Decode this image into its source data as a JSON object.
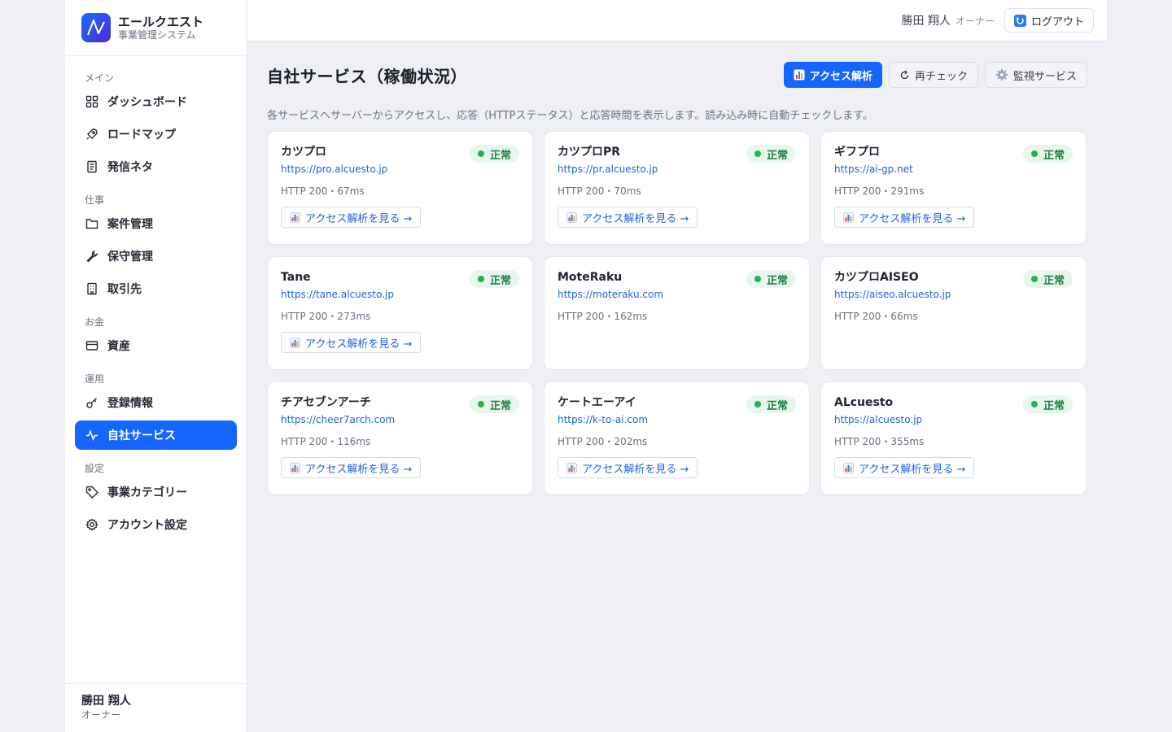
{
  "brand": {
    "name": "エールクエスト",
    "subtitle": "事業管理システム"
  },
  "nav": {
    "groups": [
      {
        "label": "メイン",
        "items": [
          {
            "label": "ダッシュボード",
            "icon": "grid-icon"
          },
          {
            "label": "ロードマップ",
            "icon": "rocket-icon"
          },
          {
            "label": "発信ネタ",
            "icon": "document-icon"
          }
        ]
      },
      {
        "label": "仕事",
        "items": [
          {
            "label": "案件管理",
            "icon": "folder-icon"
          },
          {
            "label": "保守管理",
            "icon": "wrench-icon"
          },
          {
            "label": "取引先",
            "icon": "building-icon"
          }
        ]
      },
      {
        "label": "お金",
        "items": [
          {
            "label": "資産",
            "icon": "credit-card-icon"
          }
        ]
      },
      {
        "label": "運用",
        "items": [
          {
            "label": "登録情報",
            "icon": "key-icon"
          },
          {
            "label": "自社サービス",
            "icon": "activity-icon",
            "active": true
          }
        ]
      },
      {
        "label": "設定",
        "items": [
          {
            "label": "事業カテゴリー",
            "icon": "tag-icon"
          },
          {
            "label": "アカウント設定",
            "icon": "gear-icon"
          }
        ]
      }
    ]
  },
  "user": {
    "name": "勝田 翔人",
    "role": "オーナー"
  },
  "topbar": {
    "user_name": "勝田 翔人",
    "user_role": "オーナー",
    "logout_label": "ログアウト"
  },
  "page": {
    "title": "自社サービス（稼働状況）",
    "description": "各サービスへサーバーからアクセスし、応答（HTTPステータス）と応答時間を表示します。読み込み時に自動チェックします。",
    "actions": {
      "analytics": "アクセス解析",
      "recheck": "再チェック",
      "monitor": "監視サービス"
    }
  },
  "link_label": "アクセス解析を見る →",
  "colors": {
    "accent": "#1565ff",
    "ok": "#24b14f",
    "link": "#1f63e6"
  },
  "services": [
    {
      "name": "カツプロ",
      "url": "https://pro.alcuesto.jp",
      "http": "HTTP 200・67ms",
      "status": "正常",
      "has_link": true
    },
    {
      "name": "カツプロPR",
      "url": "https://pr.alcuesto.jp",
      "http": "HTTP 200・70ms",
      "status": "正常",
      "has_link": true
    },
    {
      "name": "ギフプロ",
      "url": "https://ai-gp.net",
      "http": "HTTP 200・291ms",
      "status": "正常",
      "has_link": true
    },
    {
      "name": "Tane",
      "url": "https://tane.alcuesto.jp",
      "http": "HTTP 200・273ms",
      "status": "正常",
      "has_link": true
    },
    {
      "name": "MoteRaku",
      "url": "https://moteraku.com",
      "http": "HTTP 200・162ms",
      "status": "正常",
      "has_link": false
    },
    {
      "name": "カツプロAISEO",
      "url": "https://aiseo.alcuesto.jp",
      "http": "HTTP 200・66ms",
      "status": "正常",
      "has_link": false
    },
    {
      "name": "チアセブンアーチ",
      "url": "https://cheer7arch.com",
      "http": "HTTP 200・116ms",
      "status": "正常",
      "has_link": true
    },
    {
      "name": "ケートエーアイ",
      "url": "https://k-to-ai.com",
      "http": "HTTP 200・202ms",
      "status": "正常",
      "has_link": true
    },
    {
      "name": "ALcuesto",
      "url": "https://alcuesto.jp",
      "http": "HTTP 200・355ms",
      "status": "正常",
      "has_link": true
    }
  ]
}
